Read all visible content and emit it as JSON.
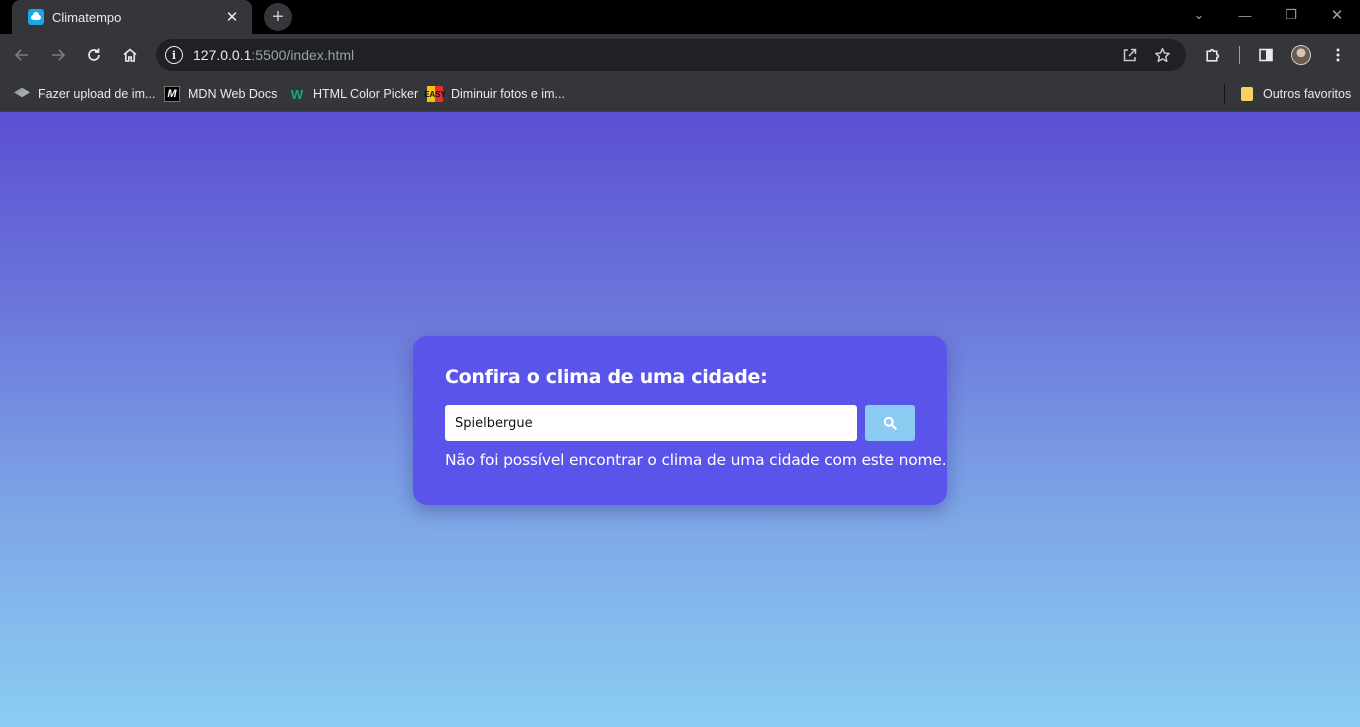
{
  "browser": {
    "tab": {
      "title": "Climatempo",
      "close_glyph": "✕"
    },
    "new_tab_glyph": "+",
    "window_controls": {
      "dropdown": "⌄",
      "minimize": "—",
      "restore": "❐",
      "close": "✕"
    },
    "toolbar": {
      "url_host": "127.0.0.1",
      "url_rest": ":5500/index.html",
      "site_info_glyph": "i"
    },
    "bookmarks": [
      {
        "label": "Fazer upload de im...",
        "icon": "layers-icon"
      },
      {
        "label": "MDN Web Docs",
        "icon": "mdn-icon",
        "glyph": "M"
      },
      {
        "label": "HTML Color Picker",
        "icon": "w3schools-icon",
        "glyph": "W"
      },
      {
        "label": "Diminuir fotos e im...",
        "icon": "easy-icon",
        "glyph": "EASY"
      }
    ],
    "other_bookmarks": "Outros favoritos"
  },
  "page": {
    "title": "Confira o clima de uma cidade:",
    "search": {
      "value": "Spielbergue",
      "placeholder": ""
    },
    "error_message": "Não foi possível encontrar o clima de uma cidade com este nome.",
    "colors": {
      "card": "#5b54ea",
      "search_button": "#8ccbf1",
      "gradient_top": "#5b4fd3",
      "gradient_bottom": "#8bcdf3"
    }
  }
}
